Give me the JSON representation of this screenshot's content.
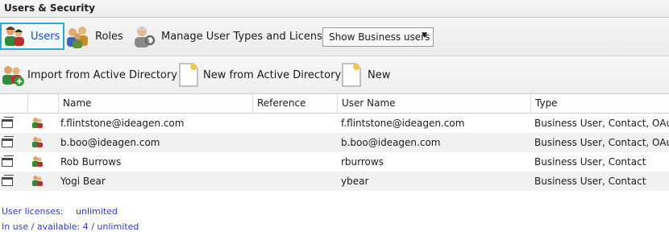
{
  "window": {
    "title": "Users & Security"
  },
  "toolbar": {
    "users_label": "Users",
    "roles_label": "Roles",
    "manage_label": "Manage User Types and Licenses",
    "filter": {
      "selected": "Show Business users"
    }
  },
  "actions": {
    "import_label": "Import from Active Directory",
    "new_from_ad_label": "New from Active Directory",
    "new_label": "New"
  },
  "table": {
    "columns": [
      "Name",
      "Reference",
      "User Name",
      "Type"
    ],
    "rows": [
      {
        "name": "f.flintstone@ideagen.com",
        "reference": "",
        "username": "f.flintstone@ideagen.com",
        "type": "Business User, Contact, OAuth"
      },
      {
        "name": "b.boo@ideagen.com",
        "reference": "",
        "username": "b.boo@ideagen.com",
        "type": "Business User, Contact, OAuth"
      },
      {
        "name": "Rob Burrows",
        "reference": "",
        "username": "rburrows",
        "type": "Business User, Contact"
      },
      {
        "name": "Yogi Bear",
        "reference": "",
        "username": "ybear",
        "type": "Business User, Contact"
      }
    ]
  },
  "footer": {
    "licenses_label": "User licenses:",
    "licenses_value": "unlimited",
    "in_use": "In use / available: 4 / unlimited"
  },
  "colors": {
    "selection_border": "#2fa8d8",
    "link_blue": "#2b3cd3"
  }
}
